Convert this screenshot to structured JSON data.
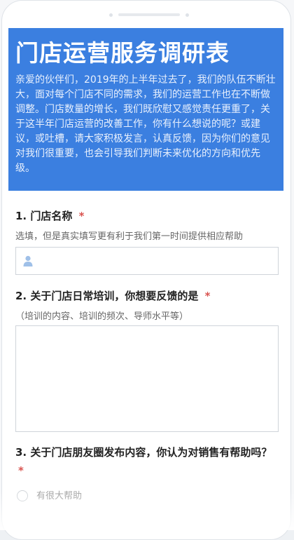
{
  "header": {
    "title": "门店运营服务调研表",
    "intro": "亲爱的伙伴们，2019年的上半年过去了，我们的队伍不断壮大，面对每个门店不同的需求，我们的运营工作也在不断做调整。门店数量的增长，我们既欣慰又感觉责任更重了，关于这半年门店运营的改善工作，你有什么想说的呢？或建议，或吐槽，请大家积极发言，认真反馈，因为你们的意见对我们很重要，也会引导我们判断未来优化的方向和优先级。"
  },
  "questions": [
    {
      "number": "1.",
      "title": "门店名称",
      "required_mark": "*",
      "description": "选填，但是真实填写更有利于我们第一时间提供相应帮助",
      "input_value": ""
    },
    {
      "number": "2.",
      "title": "关于门店日常培训，你想要反馈的是",
      "required_mark": "*",
      "description": "（培训的内容、培训的频次、导师水平等）",
      "input_value": ""
    },
    {
      "number": "3.",
      "title": "关于门店朋友圈发布内容，你认为对销售有帮助吗？",
      "required_mark": "*",
      "options": [
        "有很大帮助"
      ]
    }
  ],
  "icons": {
    "name_field": "user-icon"
  },
  "colors": {
    "header_bg": "#3b7fe0",
    "required": "#d9534f"
  }
}
